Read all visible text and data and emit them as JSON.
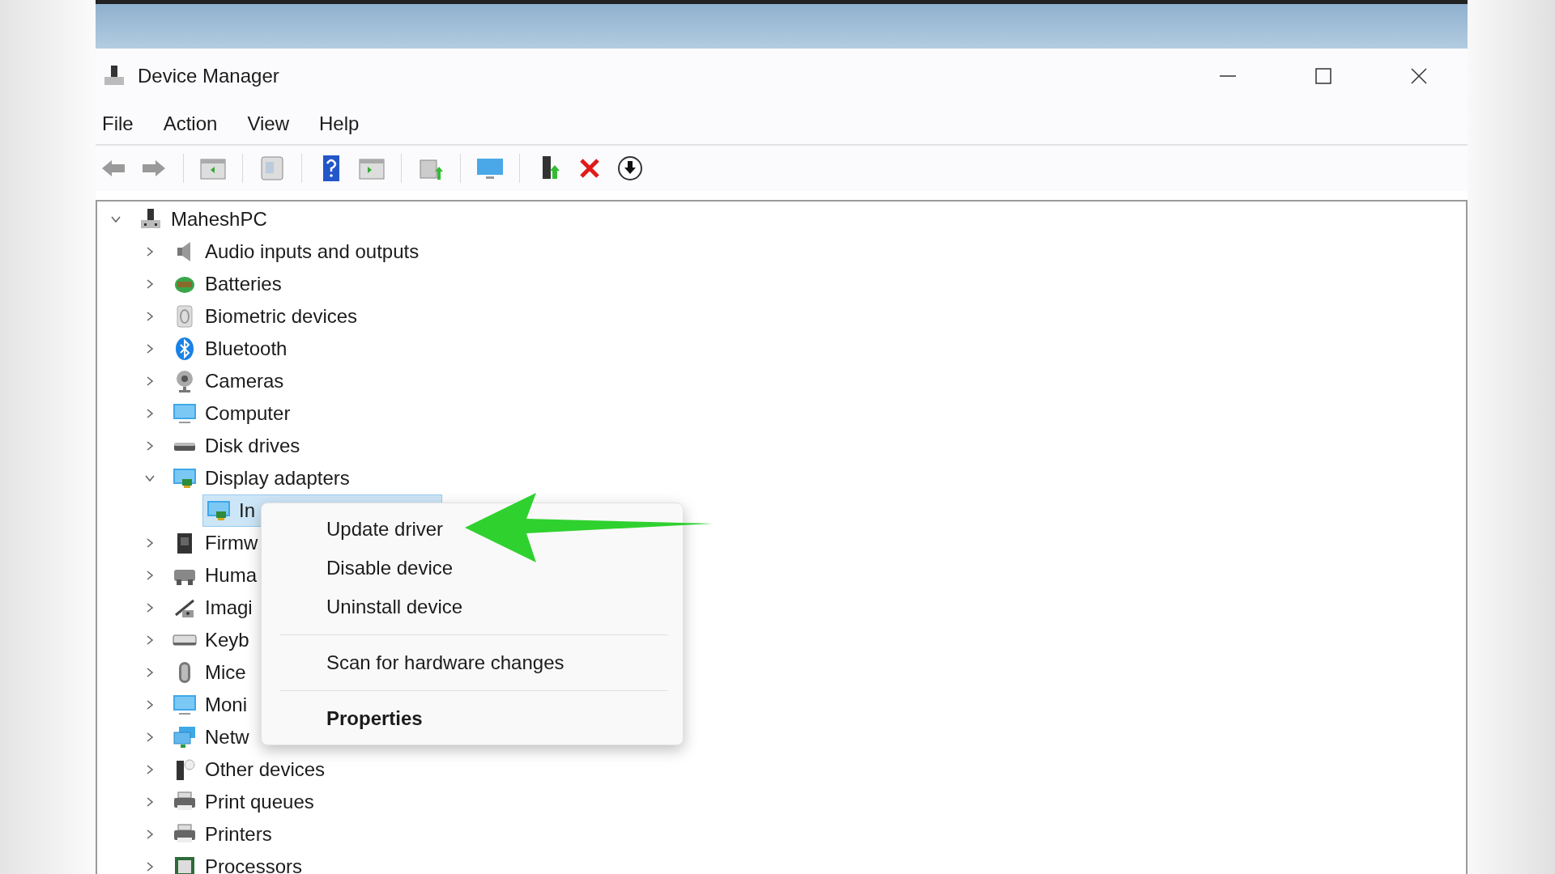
{
  "window": {
    "title": "Device Manager"
  },
  "menu": [
    "File",
    "Action",
    "View",
    "Help"
  ],
  "tree": {
    "label": "MaheshPC",
    "kind": "computer",
    "expanded": true,
    "selected": false,
    "children": [
      {
        "label": "Audio inputs and outputs",
        "kind": "audio",
        "expanded": false,
        "selected": false
      },
      {
        "label": "Batteries",
        "kind": "battery",
        "expanded": false,
        "selected": false
      },
      {
        "label": "Biometric devices",
        "kind": "biometric",
        "expanded": false,
        "selected": false
      },
      {
        "label": "Bluetooth",
        "kind": "bluetooth",
        "expanded": false,
        "selected": false
      },
      {
        "label": "Cameras",
        "kind": "camera",
        "expanded": false,
        "selected": false
      },
      {
        "label": "Computer",
        "kind": "monitor",
        "expanded": false,
        "selected": false
      },
      {
        "label": "Disk drives",
        "kind": "disk",
        "expanded": false,
        "selected": false
      },
      {
        "label": "Display adapters",
        "kind": "display",
        "expanded": true,
        "selected": false,
        "children": [
          {
            "label": "In",
            "kind": "display",
            "selected": true
          }
        ]
      },
      {
        "label": "Firmw",
        "kind": "firmware",
        "expanded": false,
        "selected": false
      },
      {
        "label": "Huma",
        "kind": "hid",
        "expanded": false,
        "selected": false
      },
      {
        "label": "Imagi",
        "kind": "imaging",
        "expanded": false,
        "selected": false
      },
      {
        "label": "Keyb",
        "kind": "keyboard",
        "expanded": false,
        "selected": false
      },
      {
        "label": "Mice",
        "kind": "mouse",
        "expanded": false,
        "selected": false
      },
      {
        "label": "Moni",
        "kind": "monitor",
        "expanded": false,
        "selected": false
      },
      {
        "label": "Netw",
        "kind": "network",
        "expanded": false,
        "selected": false
      },
      {
        "label": "Other devices",
        "kind": "other",
        "expanded": false,
        "selected": false
      },
      {
        "label": "Print queues",
        "kind": "printer",
        "expanded": false,
        "selected": false
      },
      {
        "label": "Printers",
        "kind": "printer",
        "expanded": false,
        "selected": false
      },
      {
        "label": "Processors",
        "kind": "processor",
        "expanded": false,
        "selected": false
      }
    ]
  },
  "context_menu": {
    "items": [
      {
        "kind": "item",
        "label": "Update driver",
        "default": false
      },
      {
        "kind": "item",
        "label": "Disable device",
        "default": false
      },
      {
        "kind": "item",
        "label": "Uninstall device",
        "default": false
      },
      {
        "kind": "separator"
      },
      {
        "kind": "item",
        "label": "Scan for hardware changes",
        "default": false
      },
      {
        "kind": "separator"
      },
      {
        "kind": "item",
        "label": "Properties",
        "default": true
      }
    ]
  }
}
